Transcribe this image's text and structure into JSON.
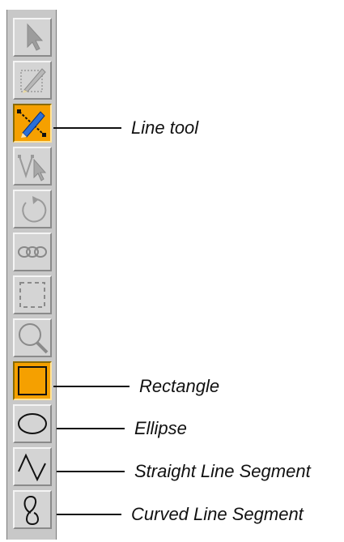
{
  "toolbar": {
    "tools": [
      {
        "icon": "arrow-select-icon",
        "active": false
      },
      {
        "icon": "pencil-draw-icon",
        "active": false
      },
      {
        "icon": "line-pencil-icon",
        "active": true
      },
      {
        "icon": "node-select-icon",
        "active": false
      },
      {
        "icon": "rotate-icon",
        "active": false
      },
      {
        "icon": "chain-link-icon",
        "active": false
      },
      {
        "icon": "marquee-select-icon",
        "active": false
      },
      {
        "icon": "magnifier-icon",
        "active": false
      },
      {
        "icon": "rectangle-icon",
        "active": true
      },
      {
        "icon": "ellipse-icon",
        "active": false
      },
      {
        "icon": "straight-segment-icon",
        "active": false
      },
      {
        "icon": "curved-segment-icon",
        "active": false
      }
    ]
  },
  "callouts": {
    "line_tool": "Line tool",
    "rectangle": "Rectangle",
    "ellipse": "Ellipse",
    "straight_segment": "Straight Line Segment",
    "curved_segment": "Curved Line Segment"
  },
  "colors": {
    "toolbar_bg": "#c8c8c8",
    "button_bg": "#d4d4d4",
    "active_bg": "#f5a000",
    "disabled_icon": "#a0a0a0",
    "enabled_icon": "#1a1a1a"
  }
}
